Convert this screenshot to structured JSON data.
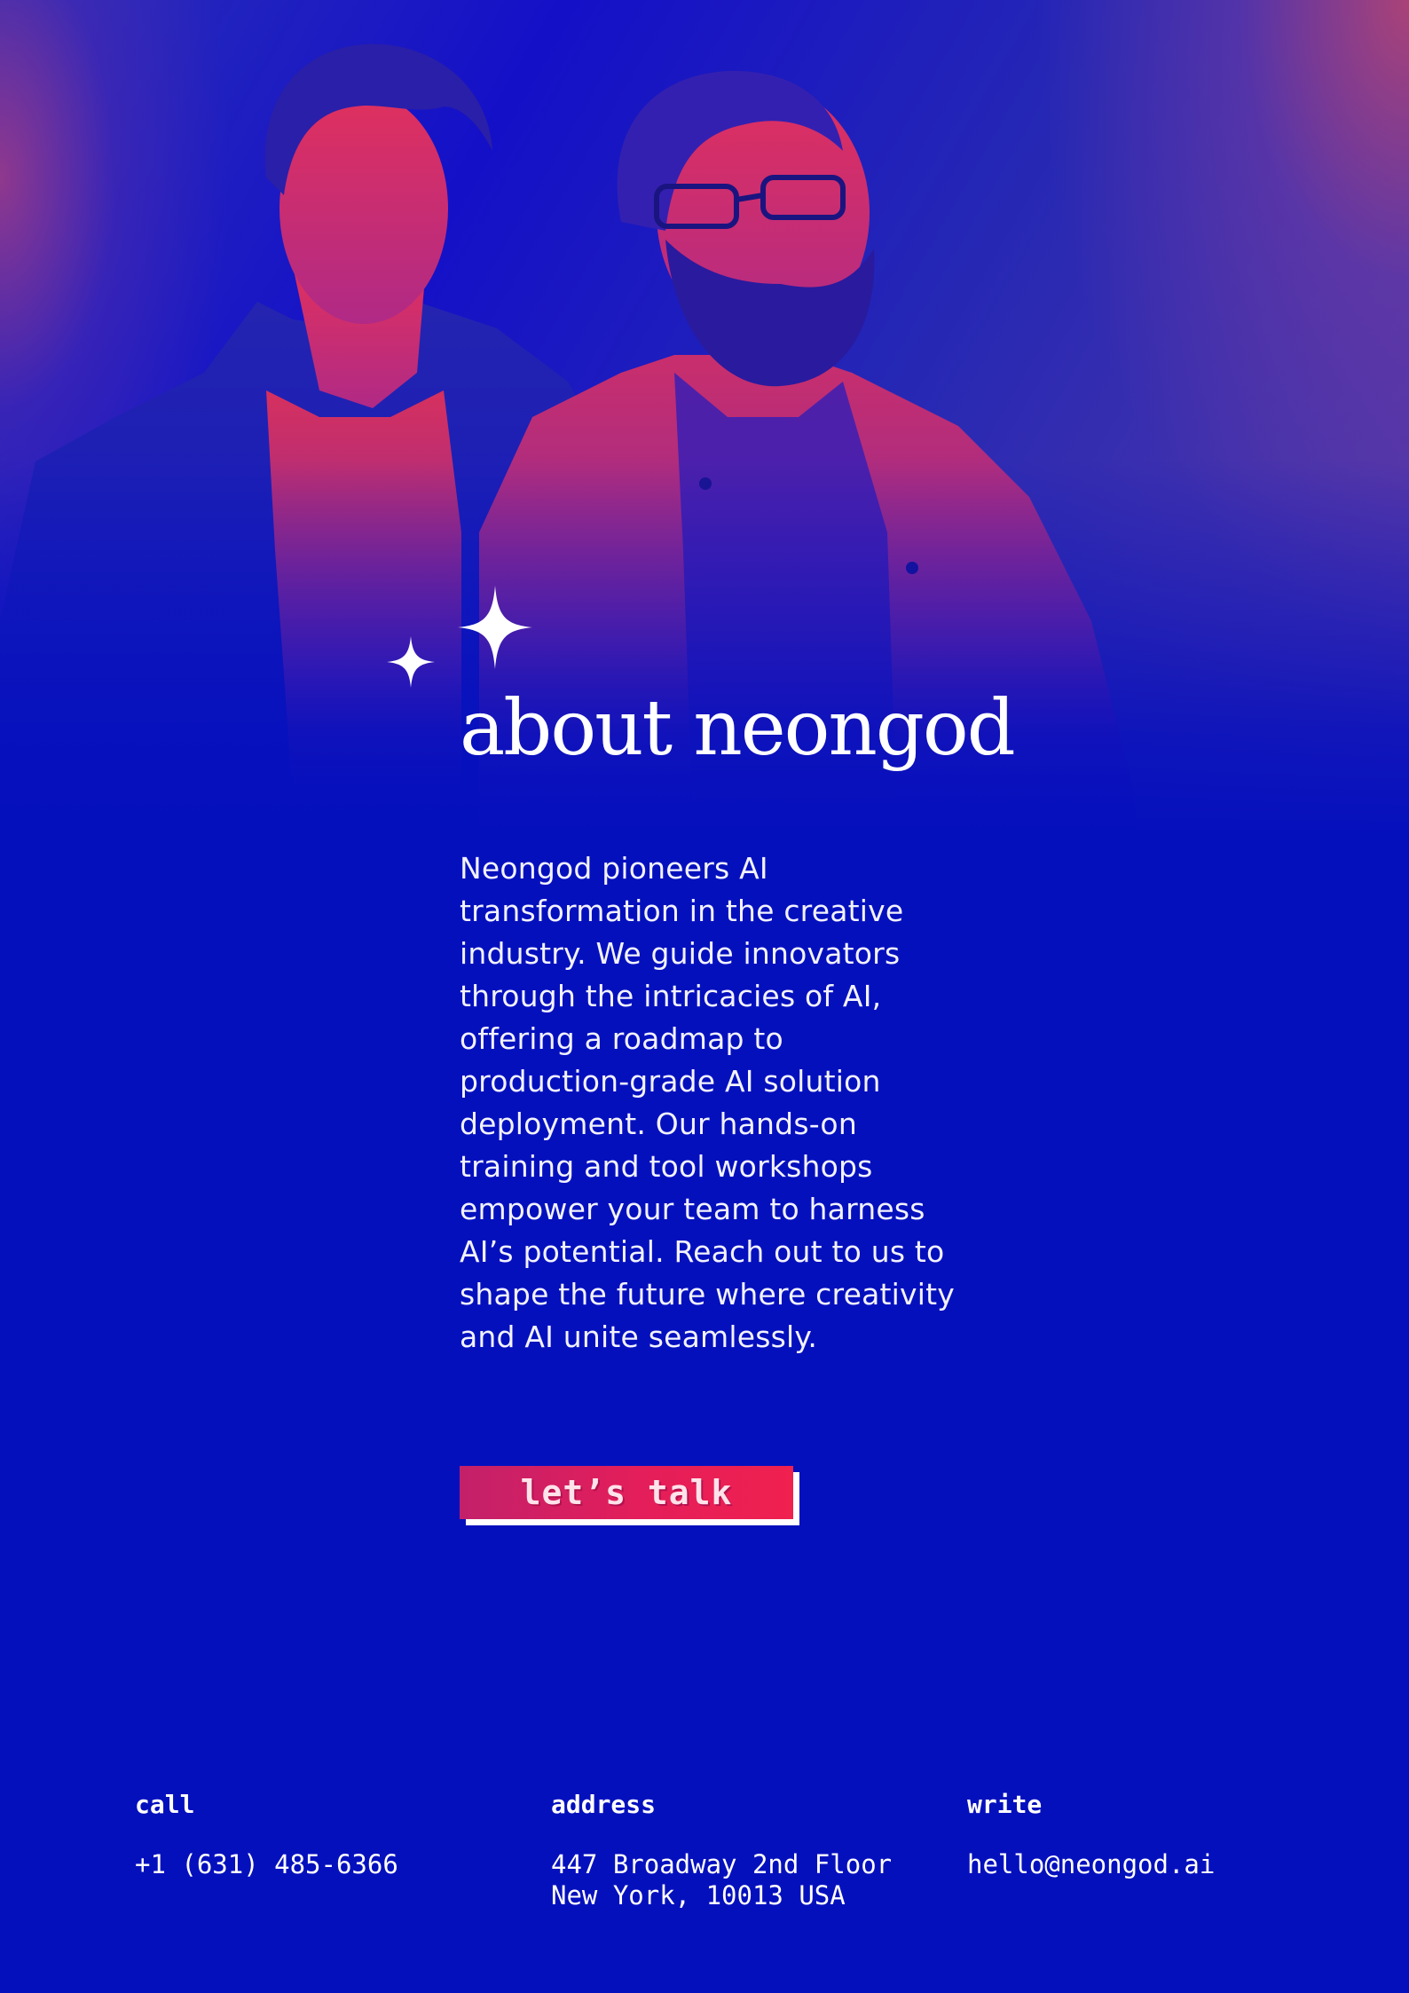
{
  "hero": {
    "image_description": "",
    "photo_icon": "duotone-portrait-photo"
  },
  "about": {
    "title": "about neongod",
    "body": "Neongod pioneers AI transformation in the creative industry. We guide innovators through the intricacies of AI, offering a roadmap to production-grade AI solution deployment. Our hands-on training and tool workshops empower your team to harness AI’s potential. Reach out to us to shape the future where creativity and AI unite seamlessly.",
    "cta_label": "let’s talk",
    "sparkle_icon": "sparkle-icon"
  },
  "footer": {
    "call": {
      "heading": "call",
      "phone": "+1 (631) 485-6366"
    },
    "address": {
      "heading": "address",
      "line1": "447 Broadway 2nd Floor",
      "line2": "New York, 10013 USA"
    },
    "write": {
      "heading": "write",
      "email": "hello@neongod.ai"
    }
  },
  "colors": {
    "background": "#0510bd",
    "accent": "#e41e5a",
    "text": "#ffffff"
  }
}
